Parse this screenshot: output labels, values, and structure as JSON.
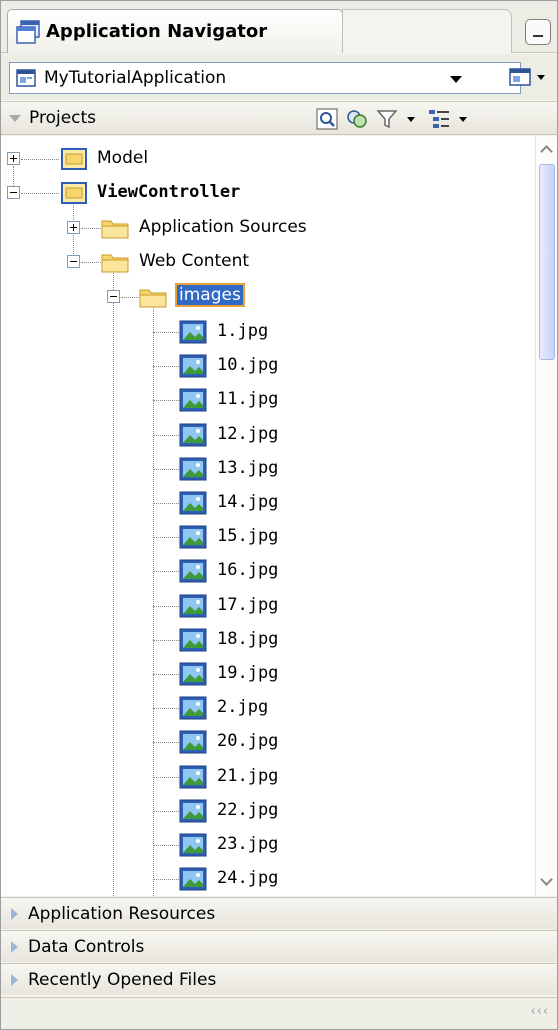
{
  "window": {
    "title": "Application Navigator"
  },
  "app_selector": {
    "selected": "MyTutorialApplication"
  },
  "projects_panel": {
    "label": "Projects"
  },
  "tree": {
    "model": "Model",
    "view_controller": "ViewController",
    "application_sources": "Application Sources",
    "web_content": "Web Content",
    "images_folder": "images",
    "files": [
      "1.jpg",
      "10.jpg",
      "11.jpg",
      "12.jpg",
      "13.jpg",
      "14.jpg",
      "15.jpg",
      "16.jpg",
      "17.jpg",
      "18.jpg",
      "19.jpg",
      "2.jpg",
      "20.jpg",
      "21.jpg",
      "22.jpg",
      "23.jpg",
      "24.jpg"
    ]
  },
  "accordion": [
    {
      "label": "Application Resources"
    },
    {
      "label": "Data Controls"
    },
    {
      "label": "Recently Opened Files"
    }
  ],
  "status": {
    "grip": "‹‹‹"
  },
  "icons": {
    "window": "application-navigator-icon",
    "app": "application-icon",
    "folder": "folder-icon",
    "project": "project-folder-icon",
    "file": "image-file-icon"
  }
}
